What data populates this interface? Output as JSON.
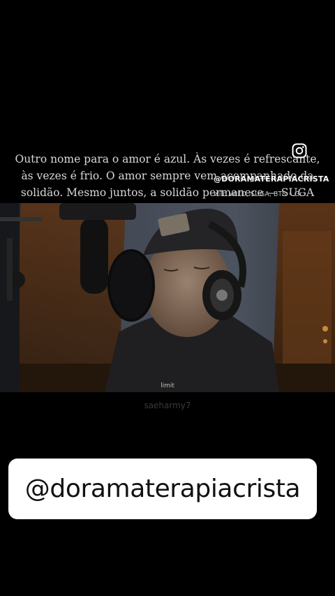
{
  "quote": {
    "line1": "Outro nome para o amor é azul. Às vezes é refrescante,",
    "line2": "às vezes é frio. O amor sempre vem acompanhado da",
    "line3": "solidão. Mesmo juntos, a solidão permanece — SUGA"
  },
  "overlay": {
    "icon": "instagram-icon",
    "handle": "@DORAMATERAPIACRISTA",
    "credit": "wild WILD, SUGA, BTS • Gr"
  },
  "video": {
    "caption": "limit",
    "watermark": "saeharmy7"
  },
  "banner": {
    "handle": "@doramaterapiacrista"
  },
  "colors": {
    "background": "#000000",
    "banner": "#ffffff",
    "quote_text": "#d8d8d8"
  }
}
